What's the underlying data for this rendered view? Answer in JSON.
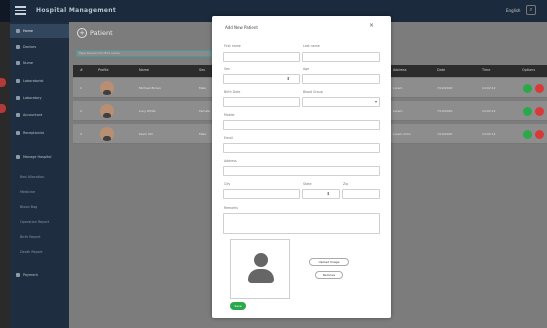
{
  "app": {
    "title": "Hospital Management",
    "language": "English"
  },
  "sidebar": {
    "items": [
      {
        "label": "Home"
      },
      {
        "label": "Doctors"
      },
      {
        "label": "Nurse"
      },
      {
        "label": "Laboratorist"
      },
      {
        "label": "Laboratory"
      },
      {
        "label": "Accountant"
      },
      {
        "label": "Receptionist"
      },
      {
        "label": "Manage Hospital"
      },
      {
        "label": "Bed Allocation"
      },
      {
        "label": "Medicine"
      },
      {
        "label": "Blood Bag"
      },
      {
        "label": "Operation Report"
      },
      {
        "label": "Birth Report"
      },
      {
        "label": "Death Report"
      },
      {
        "label": "Payment"
      }
    ]
  },
  "page": {
    "title": "Patient",
    "search_placeholder": "Type keyword to find name"
  },
  "table": {
    "headers": [
      "#",
      "Profile",
      "Name",
      "Sex",
      "Address",
      "Date",
      "Time",
      "Options"
    ],
    "rows": [
      {
        "num": "1",
        "name": "Michael Brown",
        "sex": "Male",
        "address": "Lorem",
        "date": "7/10/2020",
        "time": "14:02:12"
      },
      {
        "num": "2",
        "name": "Lucy White",
        "sex": "Female",
        "address": "Lorem",
        "date": "7/10/2020",
        "time": "14:02:12"
      },
      {
        "num": "3",
        "name": "Kevin Hill",
        "sex": "Male",
        "address": "Lorem dolor",
        "date": "7/10/2020",
        "time": "14:02:12"
      }
    ]
  },
  "modal": {
    "title": "Add New Patient",
    "close": "×",
    "first_name_label": "First name",
    "last_name_label": "Last name",
    "sex_label": "Sex",
    "age_label": "Age",
    "birth_date_label": "Birth Date",
    "blood_group_label": "Blood Group",
    "mobile_label": "Mobile",
    "email_label": "Email",
    "address_label": "Address",
    "city_label": "City",
    "state_label": "State",
    "zip_label": "Zip",
    "remarks_label": "Remarks",
    "upload_label": "Upload Image",
    "remove_label": "Remove",
    "save_label": "Save"
  },
  "colors": {
    "accent_green": "#2aa84a",
    "danger_red": "#d83a3a",
    "nav_dark": "#1e2d40"
  }
}
